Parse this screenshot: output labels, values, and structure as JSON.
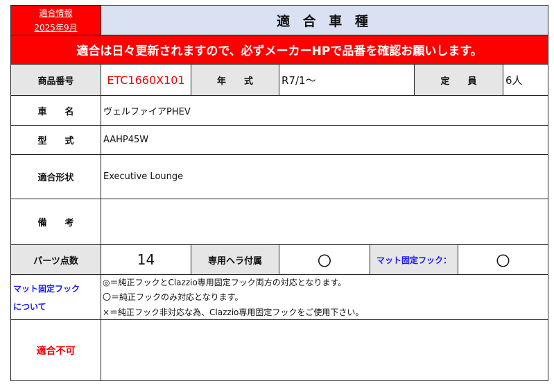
{
  "header": {
    "info_label": "適合情報",
    "date": "2025年9月",
    "title": "適 合 車 種"
  },
  "notice": "適合は日々更新されますので、必ずメーカーHPで品番を確認お願いします。",
  "row1": {
    "product_no_label": "商品番号",
    "product_no": "ETC1660X101",
    "year_label": "年　　式",
    "year": "R7/1〜",
    "capacity_label": "定　　員",
    "capacity": "6人"
  },
  "vehicle_label": "車　　名",
  "vehicle": "ヴェルファイアPHEV",
  "model_label": "型　　式",
  "model": "AAHP45W",
  "shape_label": "適合形状",
  "shape": "Executive Lounge",
  "remarks_label": "備　　考",
  "remarks": "",
  "parts": {
    "count_label": "パーツ点数",
    "count": "14",
    "spatula_label": "専用ヘラ付属",
    "spatula": "〇",
    "hook_label": "マット固定フック：",
    "hook": "〇"
  },
  "hook_info": {
    "label1": "マット固定フック",
    "label2": "について",
    "lines": [
      "◎＝純正フックとClazzio専用固定フック両方の対応となります。",
      "〇＝純正フックのみ対応となります。",
      "×＝純正フック非対応な為、Clazzio専用固定フックをご使用下さい。"
    ]
  },
  "incompatible_label": "適合不可",
  "incompatible": ""
}
